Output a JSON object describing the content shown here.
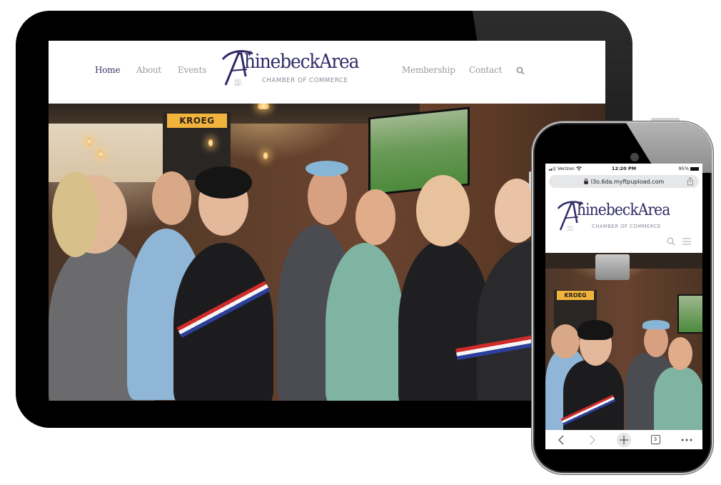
{
  "tablet": {
    "nav": {
      "items": [
        {
          "label": "Home",
          "active": true
        },
        {
          "label": "About",
          "active": false
        },
        {
          "label": "Events",
          "active": false
        },
        {
          "label": "Membership",
          "active": false
        },
        {
          "label": "Contact",
          "active": false
        }
      ],
      "search_icon": "search-icon"
    },
    "logo": {
      "wordmark": "hinebeckArea",
      "subtitle": "CHAMBER OF COMMERCE",
      "est_line1": "EST.",
      "est_line2": "1957"
    },
    "hero": {
      "sign_text": "KROEG",
      "description": "Ribbon cutting photo: group of people in a bar"
    }
  },
  "phone": {
    "status_bar": {
      "carrier": "Verizon",
      "time": "12:20 PM",
      "battery": "95%",
      "battery_level": 0.95
    },
    "url_bar": {
      "url": "l3o.6da.myftpupload.com",
      "lock_icon": "lock-icon",
      "share_icon": "share-icon"
    },
    "logo": {
      "wordmark": "hinebeckArea",
      "subtitle": "CHAMBER OF COMMERCE",
      "est_line1": "EST.",
      "est_line2": "1957"
    },
    "toolbar": {
      "back": "back-icon",
      "forward": "forward-icon",
      "new_tab": "plus-icon",
      "tab_count": "3",
      "more": "more-icon"
    }
  },
  "colors": {
    "brand_navy": "#2f2a66",
    "nav_active": "#3b3668",
    "nav_inactive": "#9a9a9a",
    "logo_subtitle": "#8a8a9a",
    "url_bar_bg": "#e6e7e9"
  }
}
